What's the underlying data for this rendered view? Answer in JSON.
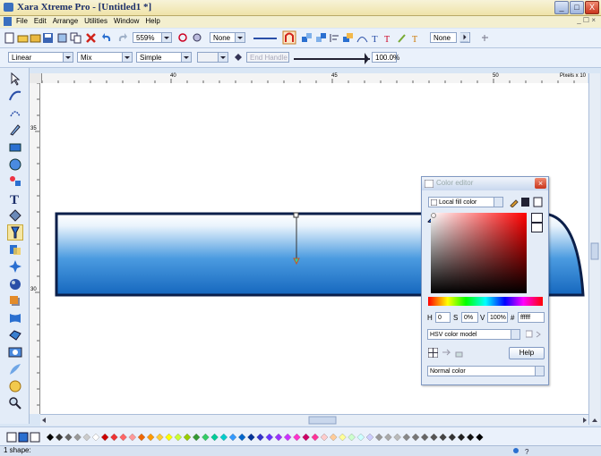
{
  "window": {
    "title": "Xara Xtreme Pro - [Untitled1 *]",
    "min_glyph": "_",
    "max_glyph": "□",
    "close_glyph": "X"
  },
  "menu": {
    "items": [
      "File",
      "Edit",
      "Arrange",
      "Utilities",
      "Window",
      "Help"
    ],
    "mdi_controls": "_ ☐ ×"
  },
  "toolbar1": {
    "zoom_value": "559%",
    "blend_value": "None",
    "none_value": "None"
  },
  "toolbar2": {
    "fill_type": "Linear",
    "fill_mix": "Mix",
    "fill_profile": "Simple",
    "end_label": "End Handle",
    "percent": "100.0%"
  },
  "rulers": {
    "top_marks": [
      "40",
      "45",
      "50"
    ],
    "units": "Pixels x 10",
    "left_marks": [
      "35",
      "30"
    ]
  },
  "color_editor": {
    "title": "Color editor",
    "local_fill": "Local fill color",
    "h_label": "H",
    "h_value": "0",
    "s_label": "S",
    "s_value": "0%",
    "v_label": "V",
    "v_value": "100%",
    "hash_label": "#",
    "hex_value": "ffffff",
    "model": "HSV color model",
    "help": "Help",
    "color_type": "Normal color"
  },
  "status": {
    "text": "1 shape:"
  },
  "colors": {
    "gradient_top": "#ffffff",
    "gradient_bottom": "#1567be",
    "outline": "#0b1f4a"
  }
}
